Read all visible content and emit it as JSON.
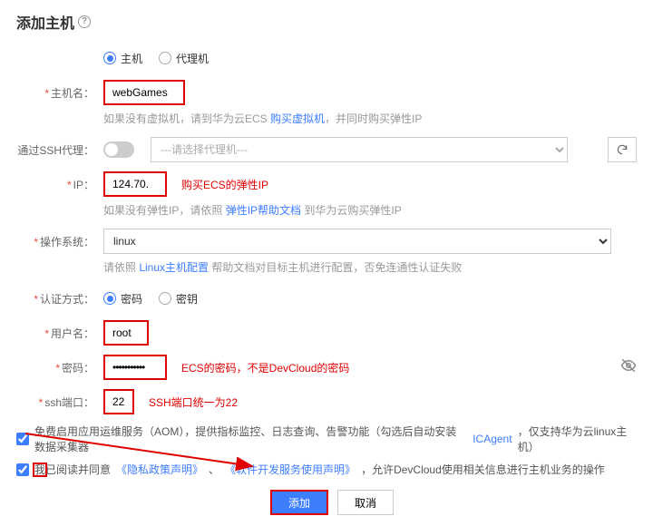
{
  "title": "添加主机",
  "mode": {
    "host": "主机",
    "proxy": "代理机"
  },
  "labels": {
    "hostName": "主机名：",
    "sshProxy": "通过SSH代理：",
    "ip": "IP：",
    "os": "操作系统：",
    "auth": "认证方式：",
    "user": "用户名：",
    "password": "密码：",
    "sshPort": "ssh端口："
  },
  "values": {
    "hostName": "webGames",
    "proxyPlaceholder": "---请选择代理机---",
    "ip": "124.70.",
    "os": "linux",
    "user": "root",
    "password": "•••••••••••",
    "sshPort": "22"
  },
  "hints": {
    "hostName_pre": "如果没有虚拟机，请到华为云ECS ",
    "hostName_link": "购买虚拟机",
    "hostName_post": "，并同时购买弹性IP",
    "ip_pre": "如果没有弹性IP，请依照 ",
    "ip_link": "弹性IP帮助文档",
    "ip_post": " 到华为云购买弹性IP",
    "os_pre": "请依照 ",
    "os_link": "Linux主机配置",
    "os_post": " 帮助文档对目标主机进行配置，否免连通性认证失败"
  },
  "annotations": {
    "ip": "购买ECS的弹性IP",
    "password": "ECS的密码，不是DevCloud的密码",
    "sshPort": "SSH端口统一为22"
  },
  "auth": {
    "password": "密码",
    "key": "密钥"
  },
  "aom": {
    "pre": "免费启用应用运维服务（AOM），提供指标监控、日志查询、告警功能（勾选后自动安装数据采集器 ",
    "link": "ICAgent",
    "post": " ，仅支持华为云linux主机）"
  },
  "agree": {
    "pre": "我已阅读并同意 ",
    "link1": "《隐私政策声明》",
    "mid": " 、",
    "link2": "《软件开发服务使用声明》",
    "post": " ，允许DevCloud使用相关信息进行主机业务的操作"
  },
  "buttons": {
    "add": "添加",
    "cancel": "取消"
  }
}
